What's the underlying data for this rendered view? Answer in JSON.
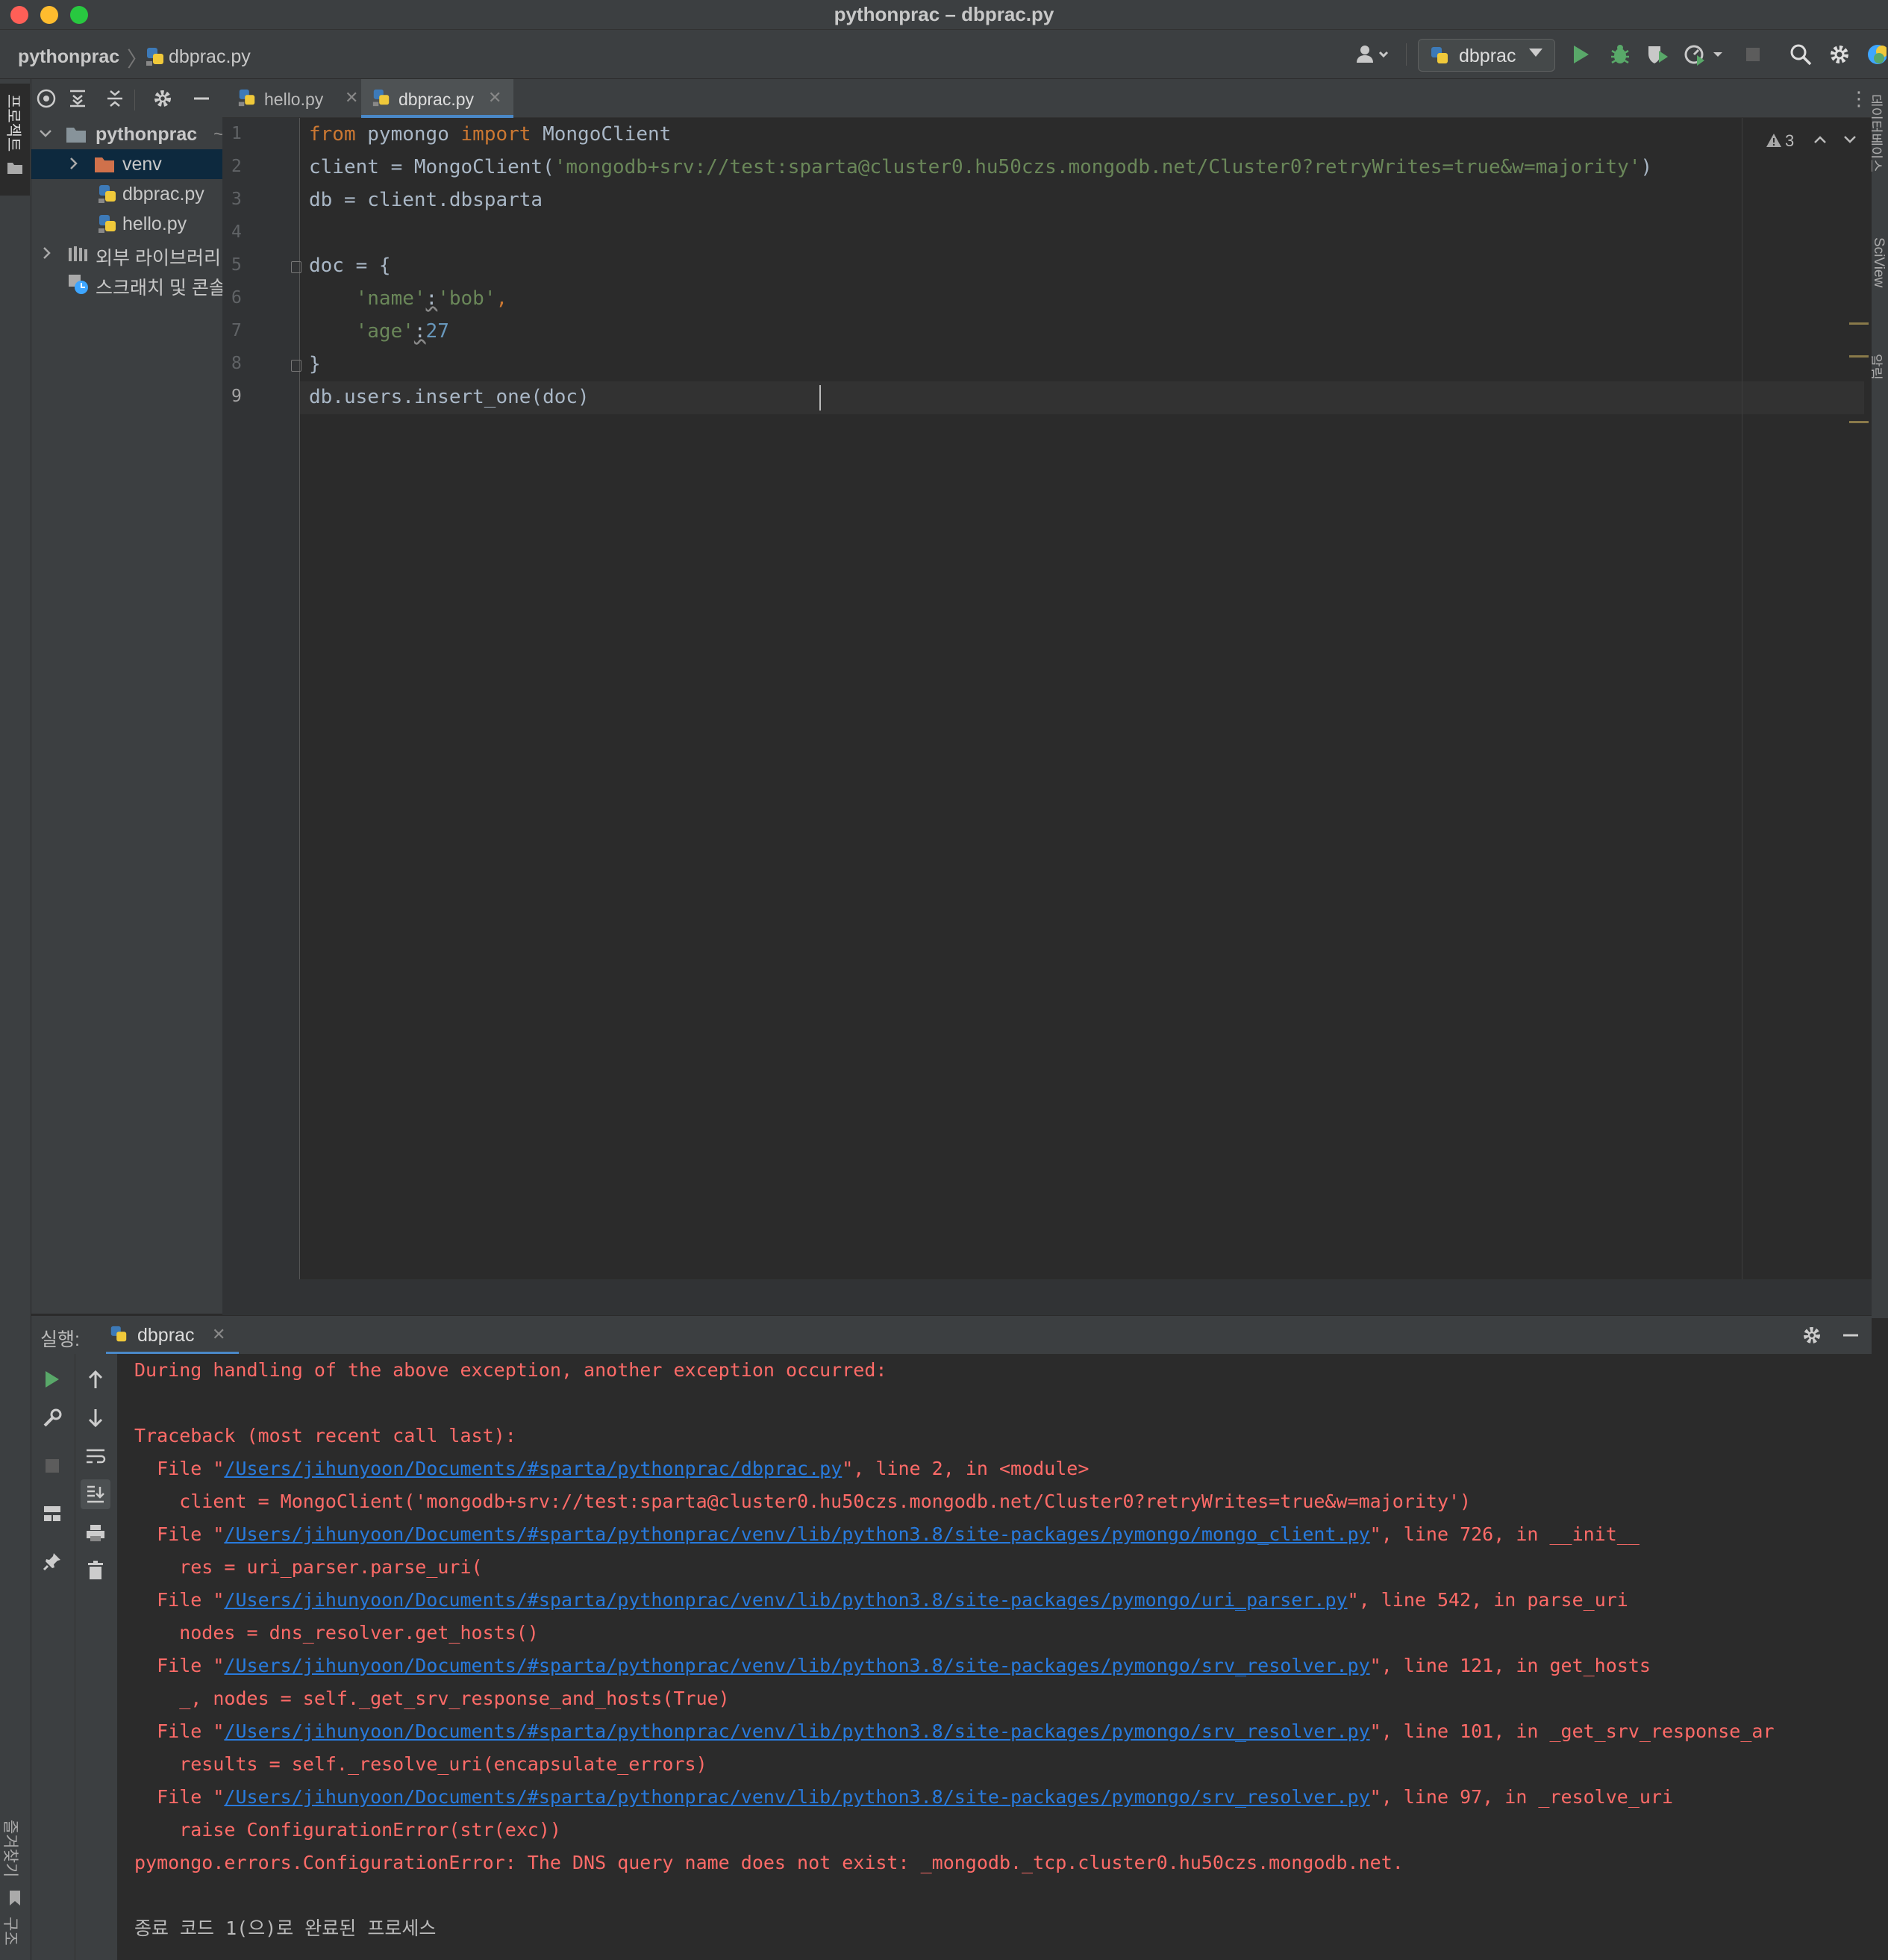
{
  "window": {
    "title": "pythonprac – dbprac.py"
  },
  "navbar": {
    "project": "pythonprac",
    "file": "dbprac.py",
    "run_config": "dbprac"
  },
  "side_stripe": {
    "project_tab": "프로젝트",
    "bottom_tab_1": "즐겨찾기",
    "bottom_tab_2": "구조",
    "right_tab_1": "데이터베이스",
    "right_tab_2": "SciView",
    "right_tab_3": "알림"
  },
  "project_tree": {
    "root": "pythonprac",
    "root_suffix": "~",
    "items": [
      {
        "label": "venv"
      },
      {
        "label": "dbprac.py"
      },
      {
        "label": "hello.py"
      },
      {
        "label": "외부 라이브러리"
      },
      {
        "label": "스크래치 및 콘솔"
      }
    ]
  },
  "tabs": [
    {
      "label": "hello.py"
    },
    {
      "label": "dbprac.py"
    }
  ],
  "editor": {
    "warning_count": "3",
    "line_numbers": [
      "1",
      "2",
      "3",
      "4",
      "5",
      "6",
      "7",
      "8",
      "9"
    ],
    "code": {
      "l1_from": "from",
      "l1_mod": " pymongo ",
      "l1_import": "import",
      "l1_name": " MongoClient",
      "l2_a": "client = MongoClient(",
      "l2_str": "'mongodb+srv://test:sparta@cluster0.hu50czs.mongodb.net/Cluster0?retryWrites=true&w=majority'",
      "l2_b": ")",
      "l3": "db = client.dbsparta",
      "l5": "doc = {",
      "l6_key": "    'name'",
      "l6_colon": ":",
      "l6_val": "'bob'",
      "l6_comma": ",",
      "l7_key": "    'age'",
      "l7_colon": ":",
      "l7_val": "27",
      "l8": "}",
      "l9": "db.users.insert_one(doc)"
    }
  },
  "run_panel": {
    "label": "실행:",
    "tab": "dbprac",
    "console": {
      "line1": "During handling of the above exception, another exception occurred:",
      "line2": "Traceback (most recent call last):",
      "frames": [
        {
          "path": "/Users/jihunyoon/Documents/#sparta/pythonprac/dbprac.py",
          "rest": "\", line 2, in <module>",
          "code": "    client = MongoClient('mongodb+srv://test:sparta@cluster0.hu50czs.mongodb.net/Cluster0?retryWrites=true&w=majority')"
        },
        {
          "path": "/Users/jihunyoon/Documents/#sparta/pythonprac/venv/lib/python3.8/site-packages/pymongo/mongo_client.py",
          "rest": "\", line 726, in __init__",
          "code": "    res = uri_parser.parse_uri("
        },
        {
          "path": "/Users/jihunyoon/Documents/#sparta/pythonprac/venv/lib/python3.8/site-packages/pymongo/uri_parser.py",
          "rest": "\", line 542, in parse_uri",
          "code": "    nodes = dns_resolver.get_hosts()"
        },
        {
          "path": "/Users/jihunyoon/Documents/#sparta/pythonprac/venv/lib/python3.8/site-packages/pymongo/srv_resolver.py",
          "rest": "\", line 121, in get_hosts",
          "code": "    _, nodes = self._get_srv_response_and_hosts(True)"
        },
        {
          "path": "/Users/jihunyoon/Documents/#sparta/pythonprac/venv/lib/python3.8/site-packages/pymongo/srv_resolver.py",
          "rest": "\", line 101, in _get_srv_response_ar",
          "code": "    results = self._resolve_uri(encapsulate_errors)"
        },
        {
          "path": "/Users/jihunyoon/Documents/#sparta/pythonprac/venv/lib/python3.8/site-packages/pymongo/srv_resolver.py",
          "rest": "\", line 97, in _resolve_uri",
          "code": "    raise ConfigurationError(str(exc))"
        }
      ],
      "file_prefix": "  File \"",
      "error": "pymongo.errors.ConfigurationError: The DNS query name does not exist: _mongodb._tcp.cluster0.hu50czs.mongodb.net.",
      "exit": "종료 코드 1(으)로 완료된 프로세스"
    }
  },
  "colors": {
    "keyword": "#cc7832",
    "string": "#6a8759",
    "number": "#6897bb",
    "error_text": "#ff6b68",
    "link": "#287bde"
  }
}
